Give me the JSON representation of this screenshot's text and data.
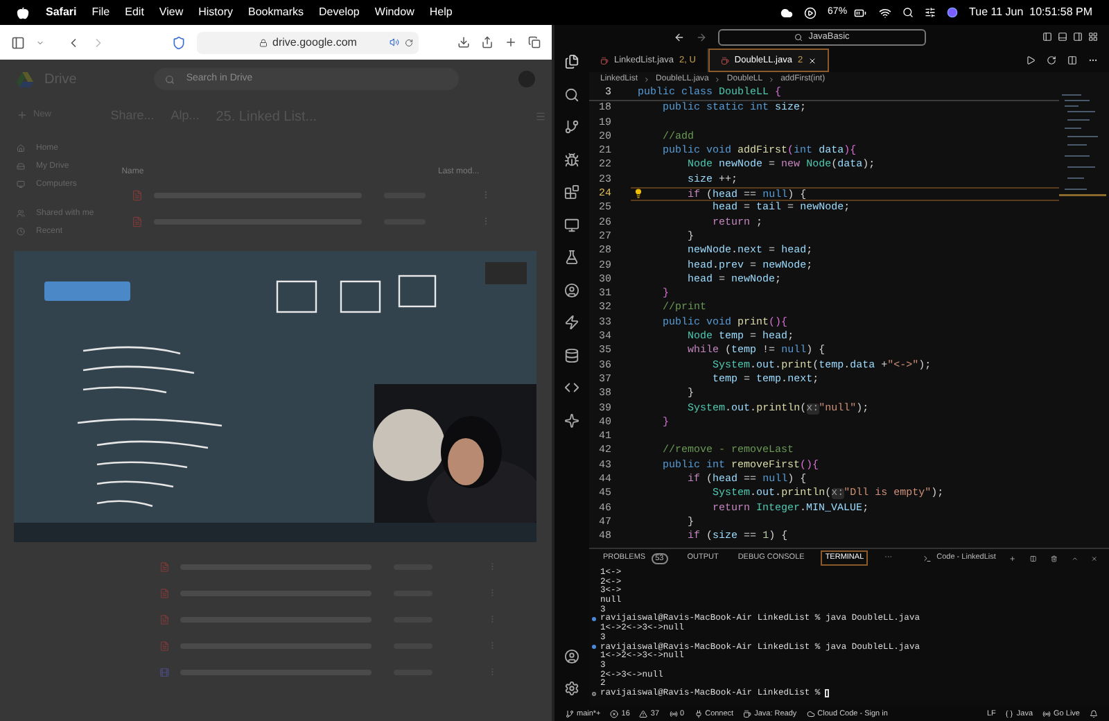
{
  "menu_bar": {
    "app_menu": [
      "Safari",
      "File",
      "Edit",
      "View",
      "History",
      "Bookmarks",
      "Develop",
      "Window",
      "Help"
    ],
    "battery_text": "67%",
    "clock": "Tue 11 Jun  10:51:58 PM"
  },
  "browser": {
    "url": "drive.google.com",
    "drive": {
      "title": "Drive",
      "search_placeholder": "Search in Drive",
      "new_button": "New",
      "sidebar": [
        "Home",
        "My Drive",
        "Computers",
        "Shared with me",
        "Recent"
      ],
      "breadcrumb": [
        "Share...",
        "Alp...",
        "25. Linked List..."
      ],
      "columns": [
        "Name",
        "Last mod..."
      ],
      "rows_above": [
        {
          "kind": "pdf"
        },
        {
          "kind": "pdf"
        }
      ],
      "video": {
        "kind": "picture"
      },
      "rows_below": [
        {
          "kind": "pdf"
        },
        {
          "kind": "pdf"
        },
        {
          "kind": "pdf"
        },
        {
          "kind": "pdf"
        },
        {
          "kind": "video"
        }
      ]
    }
  },
  "editor": {
    "search": "JavaBasic",
    "tabs": [
      {
        "name": "LinkedList.java",
        "badge": "2, U",
        "selected": false
      },
      {
        "name": "DoubleLL.java",
        "badge": "2",
        "selected": true
      }
    ],
    "breadcrumb": [
      "LinkedList",
      "DoubleLL.java",
      "DoubleLL",
      "addFirst(int)"
    ],
    "sticky_line": {
      "n": "3",
      "tokens": [
        {
          "kind": "kw",
          "text": "public class "
        },
        {
          "kind": "type",
          "text": "DoubleLL "
        },
        {
          "kind": "br",
          "text": "{"
        }
      ]
    },
    "lines": [
      {
        "n": "18",
        "current": false,
        "tokens": [
          {
            "kind": "kw",
            "text": "    public static int "
          },
          {
            "kind": "var",
            "text": "size"
          },
          {
            "kind": "p",
            "text": ";"
          }
        ]
      },
      {
        "n": "19",
        "current": false
      },
      {
        "n": "20",
        "current": false,
        "tokens": [
          {
            "kind": "com",
            "text": "    //add"
          }
        ]
      },
      {
        "n": "21",
        "current": false,
        "tokens": [
          {
            "kind": "kw",
            "text": "    public void "
          },
          {
            "kind": "fn",
            "text": "addFirst"
          },
          {
            "kind": "br",
            "text": "("
          },
          {
            "kind": "kw",
            "text": "int "
          },
          {
            "kind": "var",
            "text": "data"
          },
          {
            "kind": "br",
            "text": "){"
          }
        ]
      },
      {
        "n": "22",
        "current": false,
        "tokens": [
          {
            "kind": "type",
            "text": "        Node "
          },
          {
            "kind": "var",
            "text": "newNode"
          },
          {
            "kind": "p",
            "text": " = "
          },
          {
            "kind": "ctl",
            "text": "new "
          },
          {
            "kind": "type",
            "text": "Node"
          },
          {
            "kind": "p",
            "text": "("
          },
          {
            "kind": "var",
            "text": "data"
          },
          {
            "kind": "p",
            "text": ");"
          }
        ]
      },
      {
        "n": "23",
        "current": false,
        "tokens": [
          {
            "kind": "var",
            "text": "        size "
          },
          {
            "kind": "p",
            "text": "++;"
          }
        ]
      },
      {
        "n": "24",
        "current": true,
        "tokens": [
          {
            "kind": "ctl",
            "text": "        if "
          },
          {
            "kind": "p",
            "text": "("
          },
          {
            "kind": "var",
            "text": "head "
          },
          {
            "kind": "p",
            "text": "== "
          },
          {
            "kind": "kw",
            "text": "null"
          },
          {
            "kind": "p",
            "text": ") {"
          }
        ]
      },
      {
        "n": "25",
        "current": false,
        "tokens": [
          {
            "kind": "var",
            "text": "            head "
          },
          {
            "kind": "p",
            "text": "= "
          },
          {
            "kind": "var",
            "text": "tail "
          },
          {
            "kind": "p",
            "text": "= "
          },
          {
            "kind": "var",
            "text": "newNode"
          },
          {
            "kind": "p",
            "text": ";"
          }
        ]
      },
      {
        "n": "26",
        "current": false,
        "tokens": [
          {
            "kind": "ctl",
            "text": "            return "
          },
          {
            "kind": "p",
            "text": ";"
          }
        ]
      },
      {
        "n": "27",
        "current": false,
        "tokens": [
          {
            "kind": "p",
            "text": "        }"
          }
        ]
      },
      {
        "n": "28",
        "current": false,
        "tokens": [
          {
            "kind": "var",
            "text": "        newNode"
          },
          {
            "kind": "p",
            "text": "."
          },
          {
            "kind": "var",
            "text": "next "
          },
          {
            "kind": "p",
            "text": "= "
          },
          {
            "kind": "var",
            "text": "head"
          },
          {
            "kind": "p",
            "text": ";"
          }
        ]
      },
      {
        "n": "29",
        "current": false,
        "tokens": [
          {
            "kind": "var",
            "text": "        head"
          },
          {
            "kind": "p",
            "text": "."
          },
          {
            "kind": "var",
            "text": "prev "
          },
          {
            "kind": "p",
            "text": "= "
          },
          {
            "kind": "var",
            "text": "newNode"
          },
          {
            "kind": "p",
            "text": ";"
          }
        ]
      },
      {
        "n": "30",
        "current": false,
        "tokens": [
          {
            "kind": "var",
            "text": "        head "
          },
          {
            "kind": "p",
            "text": "= "
          },
          {
            "kind": "var",
            "text": "newNode"
          },
          {
            "kind": "p",
            "text": ";"
          }
        ]
      },
      {
        "n": "31",
        "current": false,
        "tokens": [
          {
            "kind": "br",
            "text": "    }"
          }
        ]
      },
      {
        "n": "32",
        "current": false,
        "tokens": [
          {
            "kind": "com",
            "text": "    //print"
          }
        ]
      },
      {
        "n": "33",
        "current": false,
        "tokens": [
          {
            "kind": "kw",
            "text": "    public void "
          },
          {
            "kind": "fn",
            "text": "print"
          },
          {
            "kind": "br",
            "text": "(){"
          }
        ]
      },
      {
        "n": "34",
        "current": false,
        "tokens": [
          {
            "kind": "type",
            "text": "        Node "
          },
          {
            "kind": "var",
            "text": "temp "
          },
          {
            "kind": "p",
            "text": "= "
          },
          {
            "kind": "var",
            "text": "head"
          },
          {
            "kind": "p",
            "text": ";"
          }
        ]
      },
      {
        "n": "35",
        "current": false,
        "tokens": [
          {
            "kind": "ctl",
            "text": "        while "
          },
          {
            "kind": "p",
            "text": "("
          },
          {
            "kind": "var",
            "text": "temp "
          },
          {
            "kind": "p",
            "text": "!= "
          },
          {
            "kind": "kw",
            "text": "null"
          },
          {
            "kind": "p",
            "text": ") {"
          }
        ]
      },
      {
        "n": "36",
        "current": false,
        "tokens": [
          {
            "kind": "type",
            "text": "            System"
          },
          {
            "kind": "p",
            "text": "."
          },
          {
            "kind": "var",
            "text": "out"
          },
          {
            "kind": "p",
            "text": "."
          },
          {
            "kind": "fn",
            "text": "print"
          },
          {
            "kind": "p",
            "text": "("
          },
          {
            "kind": "var",
            "text": "temp"
          },
          {
            "kind": "p",
            "text": "."
          },
          {
            "kind": "var",
            "text": "data "
          },
          {
            "kind": "p",
            "text": "+"
          },
          {
            "kind": "str",
            "text": "\"<->\""
          },
          {
            "kind": "p",
            "text": ");"
          }
        ]
      },
      {
        "n": "37",
        "current": false,
        "tokens": [
          {
            "kind": "var",
            "text": "            temp "
          },
          {
            "kind": "p",
            "text": "= "
          },
          {
            "kind": "var",
            "text": "temp"
          },
          {
            "kind": "p",
            "text": "."
          },
          {
            "kind": "var",
            "text": "next"
          },
          {
            "kind": "p",
            "text": ";"
          }
        ]
      },
      {
        "n": "38",
        "current": false,
        "tokens": [
          {
            "kind": "p",
            "text": "        }"
          }
        ]
      },
      {
        "n": "39",
        "current": false,
        "tokens": [
          {
            "kind": "type",
            "text": "        System"
          },
          {
            "kind": "p",
            "text": "."
          },
          {
            "kind": "var",
            "text": "out"
          },
          {
            "kind": "p",
            "text": "."
          },
          {
            "kind": "fn",
            "text": "println"
          },
          {
            "kind": "p",
            "text": "("
          },
          {
            "kind": "hint",
            "text": "x:"
          },
          {
            "kind": "str",
            "text": "\"null\""
          },
          {
            "kind": "p",
            "text": ");"
          }
        ]
      },
      {
        "n": "40",
        "current": false,
        "tokens": [
          {
            "kind": "br",
            "text": "    }"
          }
        ]
      },
      {
        "n": "41",
        "current": false
      },
      {
        "n": "42",
        "current": false,
        "tokens": [
          {
            "kind": "com",
            "text": "    //remove - removeLast"
          }
        ]
      },
      {
        "n": "43",
        "current": false,
        "tokens": [
          {
            "kind": "kw",
            "text": "    public int "
          },
          {
            "kind": "fn",
            "text": "removeFirst"
          },
          {
            "kind": "br",
            "text": "(){"
          }
        ]
      },
      {
        "n": "44",
        "current": false,
        "tokens": [
          {
            "kind": "ctl",
            "text": "        if "
          },
          {
            "kind": "p",
            "text": "("
          },
          {
            "kind": "var",
            "text": "head "
          },
          {
            "kind": "p",
            "text": "== "
          },
          {
            "kind": "kw",
            "text": "null"
          },
          {
            "kind": "p",
            "text": ") {"
          }
        ]
      },
      {
        "n": "45",
        "current": false,
        "tokens": [
          {
            "kind": "type",
            "text": "            System"
          },
          {
            "kind": "p",
            "text": "."
          },
          {
            "kind": "var",
            "text": "out"
          },
          {
            "kind": "p",
            "text": "."
          },
          {
            "kind": "fn",
            "text": "println"
          },
          {
            "kind": "p",
            "text": "("
          },
          {
            "kind": "hint",
            "text": "x:"
          },
          {
            "kind": "str",
            "text": "\"Dll is empty\""
          },
          {
            "kind": "p",
            "text": ");"
          }
        ]
      },
      {
        "n": "46",
        "current": false,
        "tokens": [
          {
            "kind": "ctl",
            "text": "            return "
          },
          {
            "kind": "type",
            "text": "Integer"
          },
          {
            "kind": "p",
            "text": "."
          },
          {
            "kind": "var",
            "text": "MIN_VALUE"
          },
          {
            "kind": "p",
            "text": ";"
          }
        ]
      },
      {
        "n": "47",
        "current": false,
        "tokens": [
          {
            "kind": "p",
            "text": "        }"
          }
        ]
      },
      {
        "n": "48",
        "current": false,
        "tokens": [
          {
            "kind": "ctl",
            "text": "        if "
          },
          {
            "kind": "p",
            "text": "("
          },
          {
            "kind": "var",
            "text": "size "
          },
          {
            "kind": "p",
            "text": "== "
          },
          {
            "kind": "num",
            "text": "1"
          },
          {
            "kind": "p",
            "text": ") {"
          }
        ]
      }
    ],
    "panel_tabs": [
      {
        "label": "PROBLEMS",
        "count": "53",
        "selected": false
      },
      {
        "label": "OUTPUT",
        "selected": false
      },
      {
        "label": "DEBUG CONSOLE",
        "selected": false
      },
      {
        "label": "TERMINAL",
        "selected": true
      },
      {
        "label": "···",
        "selected": false
      }
    ],
    "terminal_title": "Code - LinkedList",
    "terminal": [
      {
        "kind": "output",
        "text": "1<->"
      },
      {
        "kind": "output",
        "text": "2<->"
      },
      {
        "kind": "output",
        "text": "3<->"
      },
      {
        "kind": "output",
        "text": "null"
      },
      {
        "kind": "output",
        "text": "3"
      },
      {
        "kind": "prompt",
        "completed": true,
        "text": "ravijaiswal@Ravis-MacBook-Air LinkedList % java DoubleLL.java"
      },
      {
        "kind": "output",
        "text": "1<->2<->3<->null"
      },
      {
        "kind": "output",
        "text": "3"
      },
      {
        "kind": "prompt",
        "completed": true,
        "text": "ravijaiswal@Ravis-MacBook-Air LinkedList % java DoubleLL.java"
      },
      {
        "kind": "output",
        "text": "1<->2<->3<->null"
      },
      {
        "kind": "output",
        "text": "3"
      },
      {
        "kind": "output",
        "text": "2<->3<->null"
      },
      {
        "kind": "output",
        "text": "2"
      },
      {
        "kind": "prompt",
        "completed": false,
        "text": "ravijaiswal@Ravis-MacBook-Air LinkedList %"
      }
    ],
    "status_left": [
      {
        "kind": "branch",
        "text": "main*+"
      },
      {
        "kind": "errors",
        "text": "16"
      },
      {
        "kind": "warnings",
        "text": "37"
      },
      {
        "kind": "ports",
        "text": "0"
      },
      {
        "kind": "connect",
        "text": "Connect"
      },
      {
        "kind": "java",
        "text": "Java: Ready"
      },
      {
        "kind": "cloud",
        "text": "Cloud Code - Sign in"
      }
    ],
    "status_right": [
      {
        "kind": "plain",
        "text": "LF"
      },
      {
        "kind": "braces",
        "text": "Java"
      },
      {
        "kind": "live",
        "text": "Go Live"
      }
    ]
  }
}
